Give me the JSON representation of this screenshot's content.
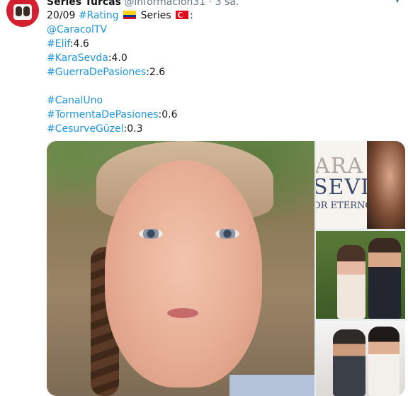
{
  "tweet": {
    "author_name": "Series Turcas",
    "handle": "@informacion31",
    "separator": "·",
    "time": "3 sa.",
    "line1": {
      "date": "20/09",
      "hashtag": "#Rating",
      "label": "Series",
      "trailing": ":"
    },
    "mention": "@CaracolTV",
    "ratings_group1": [
      {
        "tag": "#Elif",
        "value": ":4.6"
      },
      {
        "tag": "#KaraSevda",
        "value": ":4.0"
      },
      {
        "tag": "#GuerraDePasiones",
        "value": ":2.6"
      }
    ],
    "channel": "#CanalUno",
    "ratings_group2": [
      {
        "tag": "#TormentaDePasiones",
        "value": ":0.6"
      },
      {
        "tag": "#CesurveGüzel",
        "value": ":0.3"
      }
    ]
  },
  "media": {
    "thumb1": {
      "kara": "ARA",
      "sevda": "SEVDA",
      "subtitle": "OR ETERNO"
    }
  },
  "colors": {
    "link": "#1b95e0",
    "text": "#14171a",
    "muted": "#657786",
    "avatar": "#d32030"
  },
  "icons": {
    "caret": "chevron-down-icon",
    "flag_colombia": "flag-colombia-icon",
    "flag_turkey": "flag-turkey-icon"
  }
}
